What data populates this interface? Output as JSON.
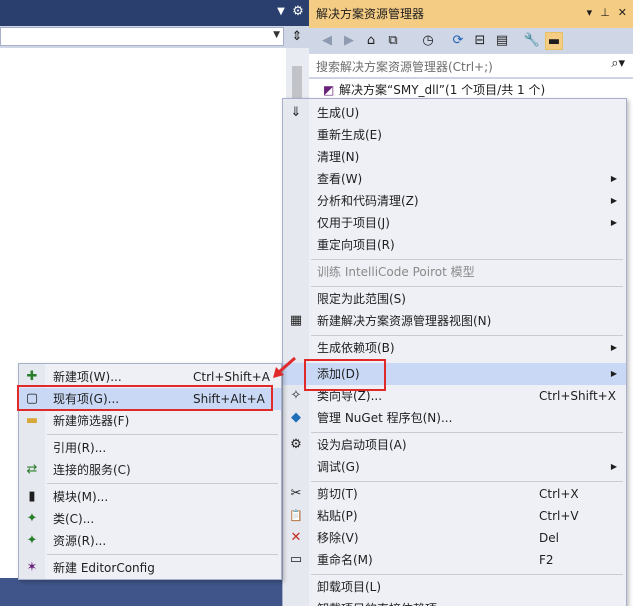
{
  "editor": {
    "dropdown_icon": "chevron-down-icon",
    "gear_icon": "gear-icon",
    "split_icon": "split-icon"
  },
  "solution_explorer": {
    "title": "解决方案资源管理器",
    "title_buttons": [
      "▾",
      "⊥",
      "✕"
    ],
    "search_placeholder": "搜索解决方案资源管理器(Ctrl+;)",
    "tree_row": "解决方案“SMY_dll”(1 个项目/共 1 个)"
  },
  "main_menu": {
    "items": [
      {
        "icon": "build-icon",
        "glyph": "⇓",
        "label": "生成(U)"
      },
      {
        "label": "重新生成(E)"
      },
      {
        "label": "清理(N)"
      },
      {
        "label": "查看(W)",
        "submenu": true
      },
      {
        "label": "分析和代码清理(Z)",
        "submenu": true
      },
      {
        "label": "仅用于项目(J)",
        "submenu": true
      },
      {
        "label": "重定向项目(R)"
      },
      {
        "label": "训练 IntelliCode Poirot 模型",
        "disabled": true
      },
      {
        "label": "限定为此范围(S)"
      },
      {
        "icon": "new-view-icon",
        "glyph": "▦",
        "label": "新建解决方案资源管理器视图(N)"
      },
      {
        "label": "生成依赖项(B)",
        "submenu": true
      },
      {
        "label": "添加(D)",
        "submenu": true,
        "highlight": true
      },
      {
        "icon": "class-wizard-icon",
        "glyph": "✧",
        "label": "类向导(Z)...",
        "shortcut": "Ctrl+Shift+X"
      },
      {
        "icon": "nuget-icon",
        "glyph": "◆",
        "label": "管理 NuGet 程序包(N)..."
      },
      {
        "icon": "gear-icon",
        "glyph": "⚙",
        "label": "设为启动项目(A)"
      },
      {
        "label": "调试(G)",
        "submenu": true
      },
      {
        "icon": "scissors-icon",
        "glyph": "✂",
        "label": "剪切(T)",
        "shortcut": "Ctrl+X"
      },
      {
        "icon": "paste-icon",
        "glyph": "📋",
        "label": "粘贴(P)",
        "shortcut": "Ctrl+V"
      },
      {
        "icon": "remove-icon",
        "glyph": "✕",
        "label": "移除(V)",
        "shortcut": "Del"
      },
      {
        "icon": "rename-icon",
        "glyph": "▭",
        "label": "重命名(M)",
        "shortcut": "F2"
      },
      {
        "label": "卸载项目(L)"
      },
      {
        "label": "卸载项目的直接依赖项"
      }
    ]
  },
  "add_submenu": {
    "items": [
      {
        "icon": "new-item-icon",
        "glyph": "✚",
        "label": "新建项(W)...",
        "shortcut": "Ctrl+Shift+A"
      },
      {
        "icon": "existing-item-icon",
        "glyph": "▢",
        "label": "现有项(G)...",
        "shortcut": "Shift+Alt+A",
        "highlight": true
      },
      {
        "icon": "folder-icon",
        "glyph": "▬",
        "label": "新建筛选器(F)"
      },
      {
        "label": "引用(R)..."
      },
      {
        "icon": "connected-service-icon",
        "glyph": "⇄",
        "label": "连接的服务(C)"
      },
      {
        "icon": "module-icon",
        "glyph": "▮",
        "label": "模块(M)..."
      },
      {
        "icon": "class-icon",
        "glyph": "✦",
        "label": "类(C)..."
      },
      {
        "icon": "resource-icon",
        "glyph": "✦",
        "label": "资源(R)..."
      },
      {
        "icon": "editorconfig-icon",
        "glyph": "✶",
        "label": "新建 EditorConfig"
      }
    ]
  },
  "colors": {
    "highlight": "#c9d8f5",
    "annotation_red": "#e02a2a",
    "explorer_title": "#f5cc84",
    "editor_frame": "#2b3f6e"
  }
}
